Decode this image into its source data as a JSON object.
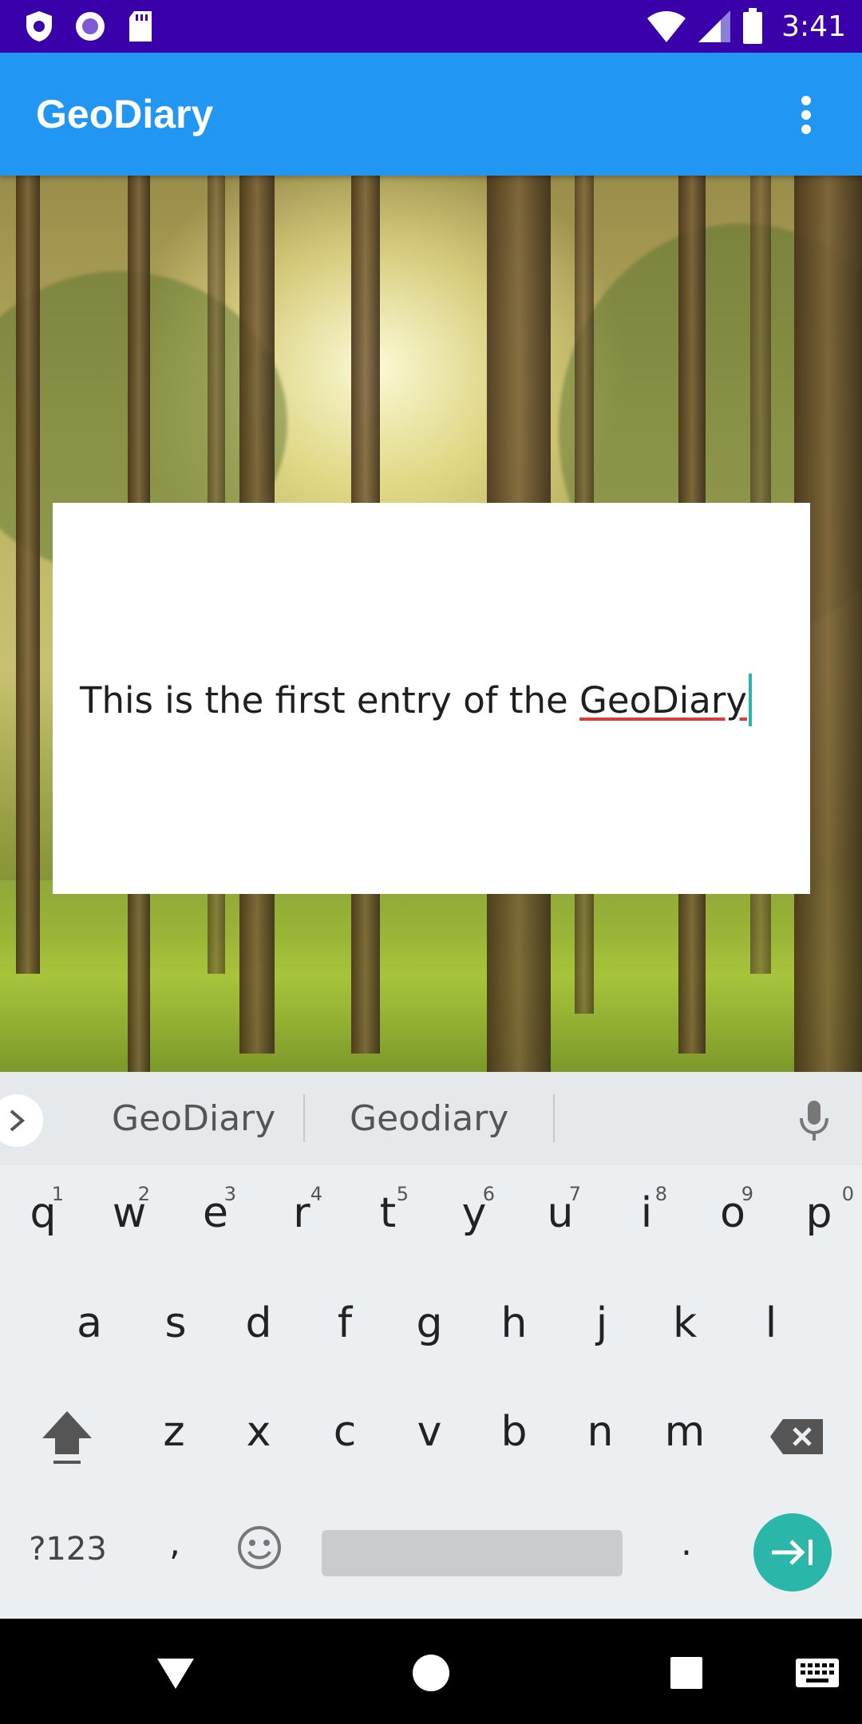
{
  "status_bar": {
    "time": "3:41",
    "icons": [
      "shield-notification-icon",
      "circle-notification-icon",
      "sd-card-icon",
      "wifi-icon",
      "signal-icon",
      "battery-icon"
    ]
  },
  "app_bar": {
    "title": "GeoDiary",
    "overflow_icon": "more-vert-icon"
  },
  "entry": {
    "text_plain": "This is the first entry of the ",
    "text_underlined": "GeoDiary"
  },
  "keyboard": {
    "suggestions": [
      "GeoDiary",
      "Geodiary"
    ],
    "row1": [
      {
        "k": "q",
        "h": "1"
      },
      {
        "k": "w",
        "h": "2"
      },
      {
        "k": "e",
        "h": "3"
      },
      {
        "k": "r",
        "h": "4"
      },
      {
        "k": "t",
        "h": "5"
      },
      {
        "k": "y",
        "h": "6"
      },
      {
        "k": "u",
        "h": "7"
      },
      {
        "k": "i",
        "h": "8"
      },
      {
        "k": "o",
        "h": "9"
      },
      {
        "k": "p",
        "h": "0"
      }
    ],
    "row2": [
      "a",
      "s",
      "d",
      "f",
      "g",
      "h",
      "j",
      "k",
      "l"
    ],
    "row3": [
      "z",
      "x",
      "c",
      "v",
      "b",
      "n",
      "m"
    ],
    "symbols_label": "?123",
    "comma": ",",
    "period": "."
  },
  "colors": {
    "status_bar": "#3a00aa",
    "app_bar": "#2196f3",
    "accent": "#2ab7a9",
    "spell_underline": "#e53935"
  }
}
